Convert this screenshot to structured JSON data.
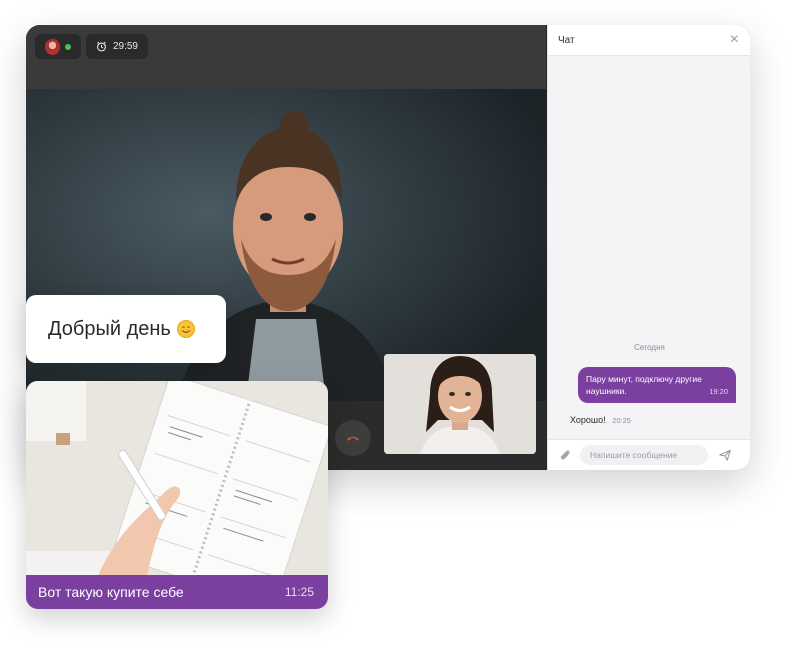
{
  "call": {
    "timer": "29:59",
    "icons": {
      "avatar": "user-avatar",
      "timer": "alarm-clock-icon",
      "end_call": "phone-hangup-icon"
    },
    "colors": {
      "online": "#3ec64f",
      "end_call": "#e0453a"
    }
  },
  "chat": {
    "title": "Чат",
    "close_icon": "close-icon",
    "date_separator": "Сегодня",
    "messages": [
      {
        "direction": "out",
        "text": "Пару минут, подключу другие наушники.",
        "time": "19:20"
      },
      {
        "direction": "in",
        "text": "Хорошо!",
        "time": "20:25"
      }
    ],
    "input": {
      "value": "",
      "placeholder": "Напишите сообщение"
    },
    "icons": {
      "attach": "paperclip-icon",
      "send": "send-icon"
    }
  },
  "greeting": {
    "text": "Добрый день",
    "emoji": "smiling-face"
  },
  "photo_message": {
    "caption": "Вот такую купите себе",
    "time": "11:25"
  },
  "colors": {
    "accent": "#7b3fa0"
  }
}
